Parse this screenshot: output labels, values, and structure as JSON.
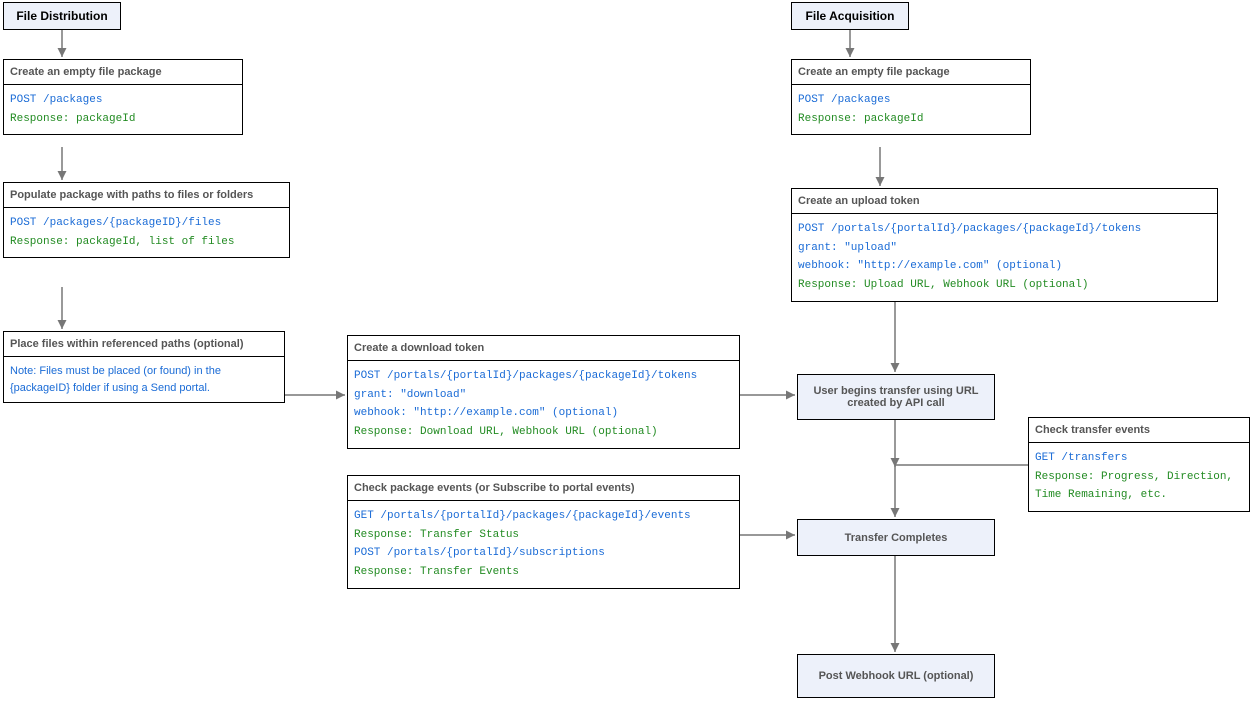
{
  "headers": {
    "distribution": "File Distribution",
    "acquisition": "File Acquisition"
  },
  "dist": {
    "create_empty": {
      "title": "Create an empty file package",
      "request": "POST /packages",
      "response": "Response: packageId"
    },
    "populate": {
      "title": "Populate package with paths to files or folders",
      "request": "POST /packages/{packageID}/files",
      "response": "Response: packageId, list of files"
    },
    "place_files": {
      "title": "Place files within referenced paths (optional)",
      "note": "Note: Files must be placed (or found) in the {packageID} folder if using a Send portal."
    }
  },
  "download_token": {
    "title": "Create a download token",
    "request1": "POST /portals/{portalId}/packages/{packageId}/tokens",
    "request2": "grant: \"download\"",
    "request3": "webhook: \"http://example.com\" (optional)",
    "response": "Response: Download URL, Webhook URL (optional)"
  },
  "check_events": {
    "title": "Check package events (or Subscribe to portal events)",
    "request1": "GET /portals/{portalId}/packages/{packageId}/events",
    "response1": "Response: Transfer Status",
    "request2": "POST /portals/{portalId}/subscriptions",
    "response2": "Response: Transfer Events"
  },
  "acq": {
    "create_empty": {
      "title": "Create an empty file package",
      "request": "POST /packages",
      "response": "Response: packageId"
    },
    "upload_token": {
      "title": "Create an upload token",
      "request1": "POST /portals/{portalId}/packages/{packageId}/tokens",
      "request2": "grant: \"upload\"",
      "request3": "webhook: \"http://example.com\" (optional)",
      "response": "Response: Upload URL, Webhook URL (optional)"
    }
  },
  "check_transfer": {
    "title": "Check transfer events",
    "request": "GET /transfers",
    "response": "Response: Progress, Direction, Time Remaining, etc."
  },
  "actions": {
    "user_transfer": "User begins transfer using URL created by API call",
    "transfer_completes": "Transfer Completes",
    "post_webhook": "Post Webhook URL (optional)"
  }
}
